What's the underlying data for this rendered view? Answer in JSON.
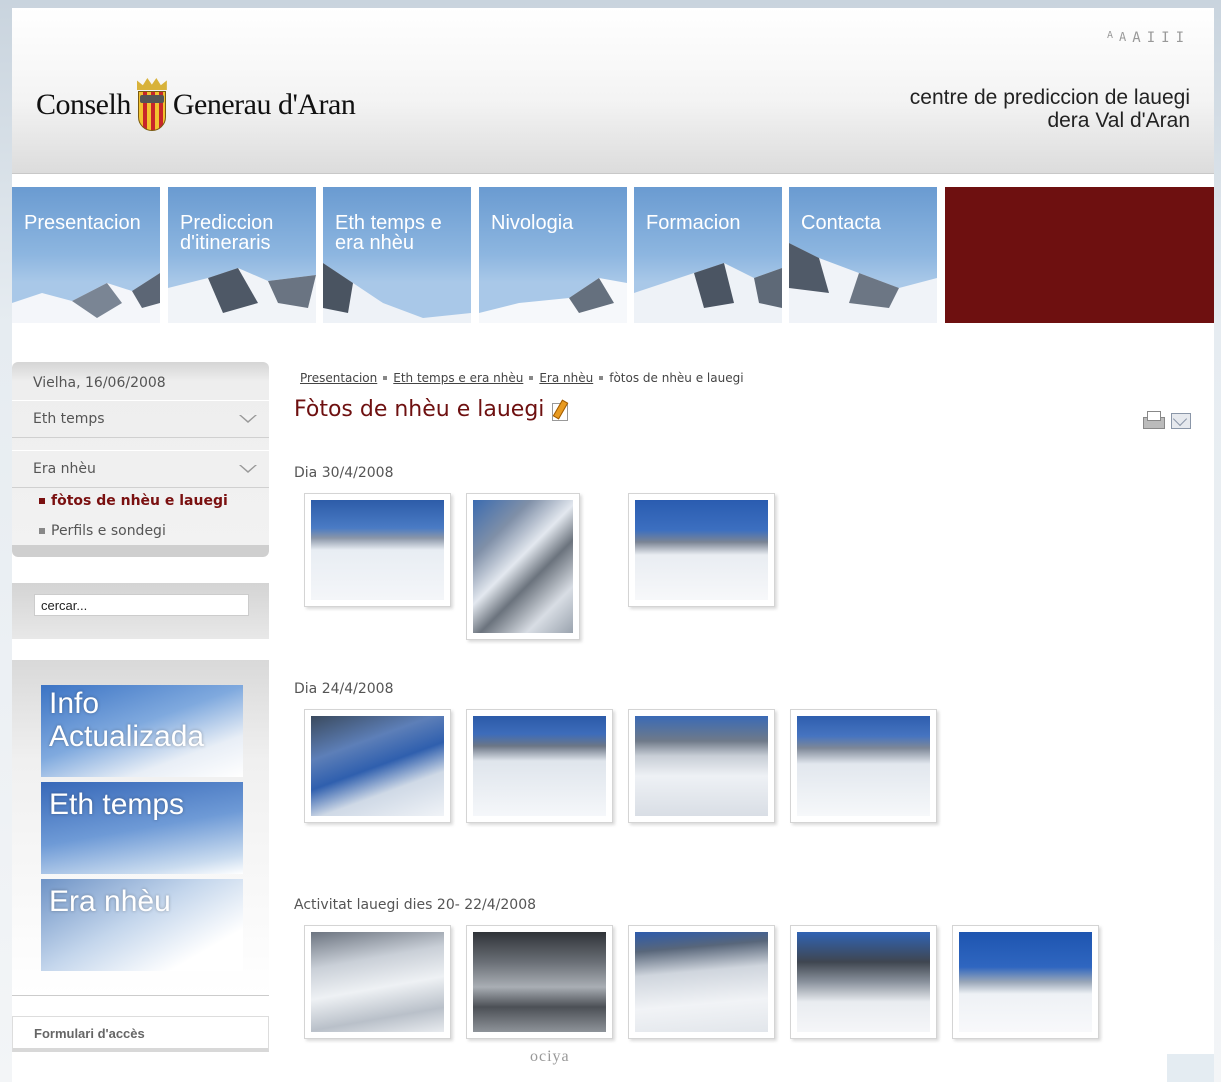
{
  "header": {
    "logo_left": "Conselh",
    "logo_right": "Generau d'Aran",
    "tagline_line1": "centre de prediccion de lauegi",
    "tagline_line2": "dera Val d'Aran",
    "accessibility_icons": [
      "A",
      "A",
      "A",
      "I",
      "I",
      "I"
    ]
  },
  "nav": {
    "tabs": [
      {
        "label": "Presentacion"
      },
      {
        "label": "Prediccion\nd'itineraris"
      },
      {
        "label": "Eth temps e\nera nhèu"
      },
      {
        "label": "Nivologia"
      },
      {
        "label": "Formacion"
      },
      {
        "label": "Contacta"
      }
    ],
    "filler_color": "#6e1010"
  },
  "sidebar": {
    "date": "Vielha, 16/06/2008",
    "menu1": "Eth temps",
    "menu2": "Era nhèu",
    "subitems": [
      "fòtos de nhèu e lauegi",
      "Perfils e sondegi"
    ],
    "search_placeholder": "cercar...",
    "promos": [
      "Info\nActualizada",
      "Eth temps",
      "Era nhèu"
    ],
    "login": "Formulari d'accès"
  },
  "main": {
    "breadcrumb": [
      "Presentacion",
      "Eth temps e era nhèu",
      "Era nhèu",
      "fòtos de nhèu e lauegi"
    ],
    "title": "Fòtos de nhèu e lauegi",
    "sections": [
      {
        "label": "Dia 30/4/2008",
        "count": 3
      },
      {
        "label": "Dia 24/4/2008",
        "count": 4
      },
      {
        "label": "Activitat lauegi dies 20- 22/4/2008",
        "count": 5
      }
    ]
  },
  "footer": {
    "partial_text": "ociya"
  },
  "colors": {
    "accent": "#6e1010",
    "sky": "#6a9bd1"
  }
}
